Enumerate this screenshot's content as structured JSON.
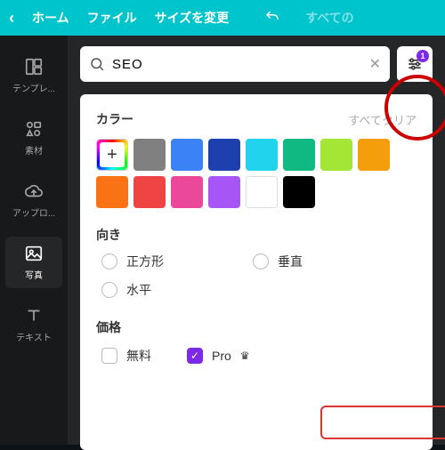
{
  "topbar": {
    "home": "ホーム",
    "file": "ファイル",
    "resize": "サイズを変更",
    "faded": "すべての"
  },
  "sidebar": {
    "items": [
      {
        "label": "テンプレ..."
      },
      {
        "label": "素材"
      },
      {
        "label": "アップロ..."
      },
      {
        "label": "写真"
      },
      {
        "label": "テキスト"
      }
    ]
  },
  "search": {
    "value": "SEO",
    "filter_badge": "1"
  },
  "filters": {
    "color_title": "カラー",
    "clear_all": "すべてクリア",
    "colors": [
      "#808080",
      "#3b82f6",
      "#1e40af",
      "#06b6d4",
      "#22c55e",
      "#a3e635",
      "#f59e0b",
      "#f97316",
      "#ef4444",
      "#ec4899",
      "#a855f7",
      "#ffffff",
      "#000000"
    ],
    "orientation_title": "向き",
    "orientation": {
      "square": "正方形",
      "vertical": "垂直",
      "horizontal": "水平"
    },
    "price_title": "価格",
    "price": {
      "free": "無料",
      "pro": "Pro"
    }
  }
}
